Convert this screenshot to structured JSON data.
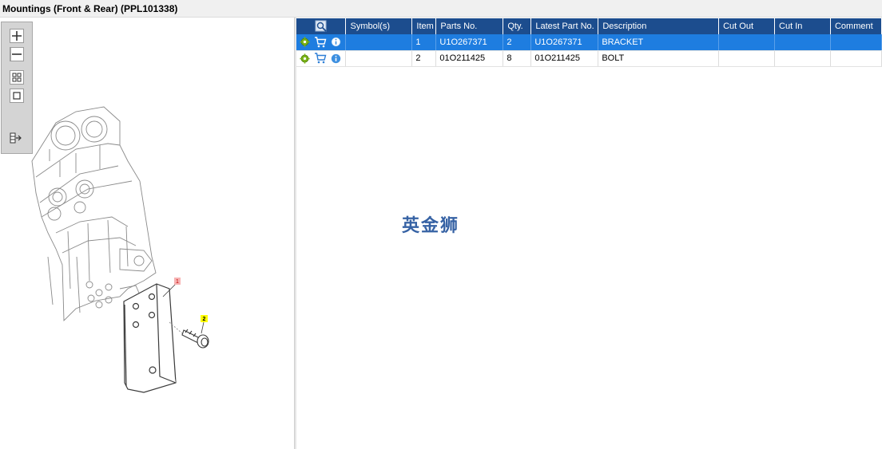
{
  "window": {
    "title": "Mountings (Front & Rear) (PPL101338)"
  },
  "drawing": {
    "callouts": [
      {
        "label": "1",
        "color": "#f7b3b3"
      },
      {
        "label": "2",
        "color": "#ffff00"
      }
    ]
  },
  "toolbar": {
    "tools": [
      {
        "icon": "zoom-in-icon"
      },
      {
        "icon": "zoom-out-icon"
      },
      {
        "icon": "grid-view-icon"
      },
      {
        "icon": "fit-page-icon"
      },
      {
        "icon": "export-list-icon"
      }
    ]
  },
  "parts_table": {
    "columns": [
      "Symbol(s)",
      "Item",
      "Parts No.",
      "Qty.",
      "Latest Part No.",
      "Description",
      "Cut Out",
      "Cut In",
      "Comment"
    ],
    "rows": [
      {
        "item": "1",
        "part_no": "U1O267371",
        "qty": "2",
        "latest_part_no": "U1O267371",
        "description": "BRACKET",
        "selected": true
      },
      {
        "item": "2",
        "part_no": "01O211425",
        "qty": "8",
        "latest_part_no": "01O211425",
        "description": "BOLT",
        "selected": false
      }
    ],
    "row_icons": [
      "gear-icon",
      "cart-icon",
      "info-icon"
    ]
  },
  "watermark": {
    "text": "英金狮"
  },
  "colors": {
    "header_bg": "#1c4d8e",
    "selected_row": "#1e7de0",
    "gear": "#7ab317",
    "cart": "#2e7fd6",
    "info": "#3c8fe0"
  }
}
